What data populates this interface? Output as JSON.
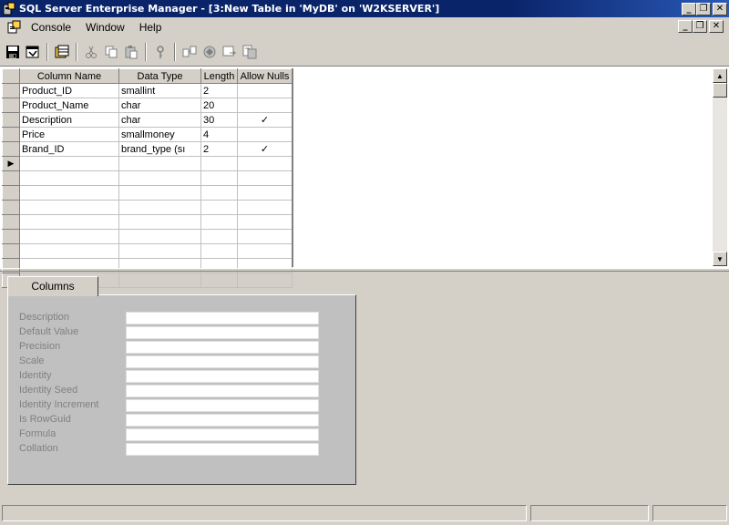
{
  "window": {
    "title": "SQL Server Enterprise Manager - [3:New Table in 'MyDB' on 'W2KSERVER']",
    "minimize": "_",
    "restore": "❐",
    "close": "✕"
  },
  "menubar": {
    "items": [
      {
        "label": "Console"
      },
      {
        "label": "Window"
      },
      {
        "label": "Help"
      }
    ]
  },
  "toolbar": {
    "buttons": [
      "save-icon",
      "properties-icon",
      "table-properties-icon",
      "cut-icon",
      "copy-icon",
      "paste-icon",
      "primary-key-icon",
      "relationships-icon",
      "indexes-icon",
      "constraints-icon",
      "generate-script-icon"
    ]
  },
  "grid": {
    "columns": [
      "Column Name",
      "Data Type",
      "Length",
      "Allow Nulls"
    ],
    "rows": [
      {
        "name": "Product_ID",
        "type": "smallint",
        "length": "2",
        "nulls": ""
      },
      {
        "name": "Product_Name",
        "type": "char",
        "length": "20",
        "nulls": ""
      },
      {
        "name": "Description",
        "type": "char",
        "length": "30",
        "nulls": "✓"
      },
      {
        "name": "Price",
        "type": "smallmoney",
        "length": "4",
        "nulls": ""
      },
      {
        "name": "Brand_ID",
        "type": "brand_type (sı",
        "length": "2",
        "nulls": "✓"
      }
    ],
    "current_row_marker": "▶",
    "empty_rows": 8
  },
  "details": {
    "tab_label": "Columns",
    "properties": [
      {
        "label": "Description",
        "value": ""
      },
      {
        "label": "Default Value",
        "value": ""
      },
      {
        "label": "Precision",
        "value": ""
      },
      {
        "label": "Scale",
        "value": ""
      },
      {
        "label": "Identity",
        "value": ""
      },
      {
        "label": "Identity Seed",
        "value": ""
      },
      {
        "label": "Identity Increment",
        "value": ""
      },
      {
        "label": "Is RowGuid",
        "value": ""
      },
      {
        "label": "Formula",
        "value": ""
      },
      {
        "label": "Collation",
        "value": ""
      }
    ]
  }
}
